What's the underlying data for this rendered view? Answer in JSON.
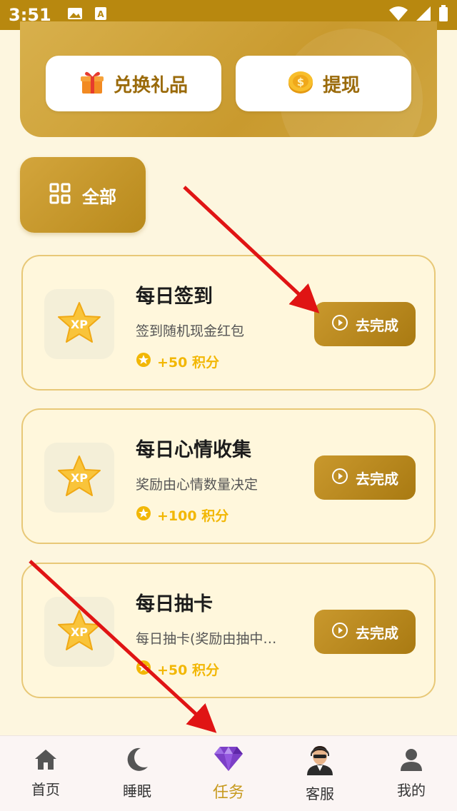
{
  "status_bar": {
    "time": "3:51"
  },
  "top_actions": {
    "exchange_label": "兑换礼品",
    "withdraw_label": "提现"
  },
  "filter": {
    "all_label": "全部"
  },
  "tasks": [
    {
      "title": "每日签到",
      "description": "签到随机现金红包",
      "points": "+50 积分",
      "button": "去完成",
      "icon_text": "XP"
    },
    {
      "title": "每日心情收集",
      "description": "奖励由心情数量决定",
      "points": "+100 积分",
      "button": "去完成",
      "icon_text": "XP"
    },
    {
      "title": "每日抽卡",
      "description": "每日抽卡(奖励由抽中…",
      "points": "+50 积分",
      "button": "去完成",
      "icon_text": "XP"
    }
  ],
  "bottom_nav": [
    {
      "label": "首页",
      "icon": "home-icon"
    },
    {
      "label": "睡眠",
      "icon": "moon-icon"
    },
    {
      "label": "任务",
      "icon": "diamond-icon",
      "active": true
    },
    {
      "label": "客服",
      "icon": "agent-avatar-icon"
    },
    {
      "label": "我的",
      "icon": "person-icon"
    }
  ],
  "colors": {
    "status_bar": "#b8880f",
    "accent_gold": "#c99a2e",
    "points_yellow": "#f2b705",
    "annotation_red": "#e01414",
    "background": "#fdf6df"
  }
}
